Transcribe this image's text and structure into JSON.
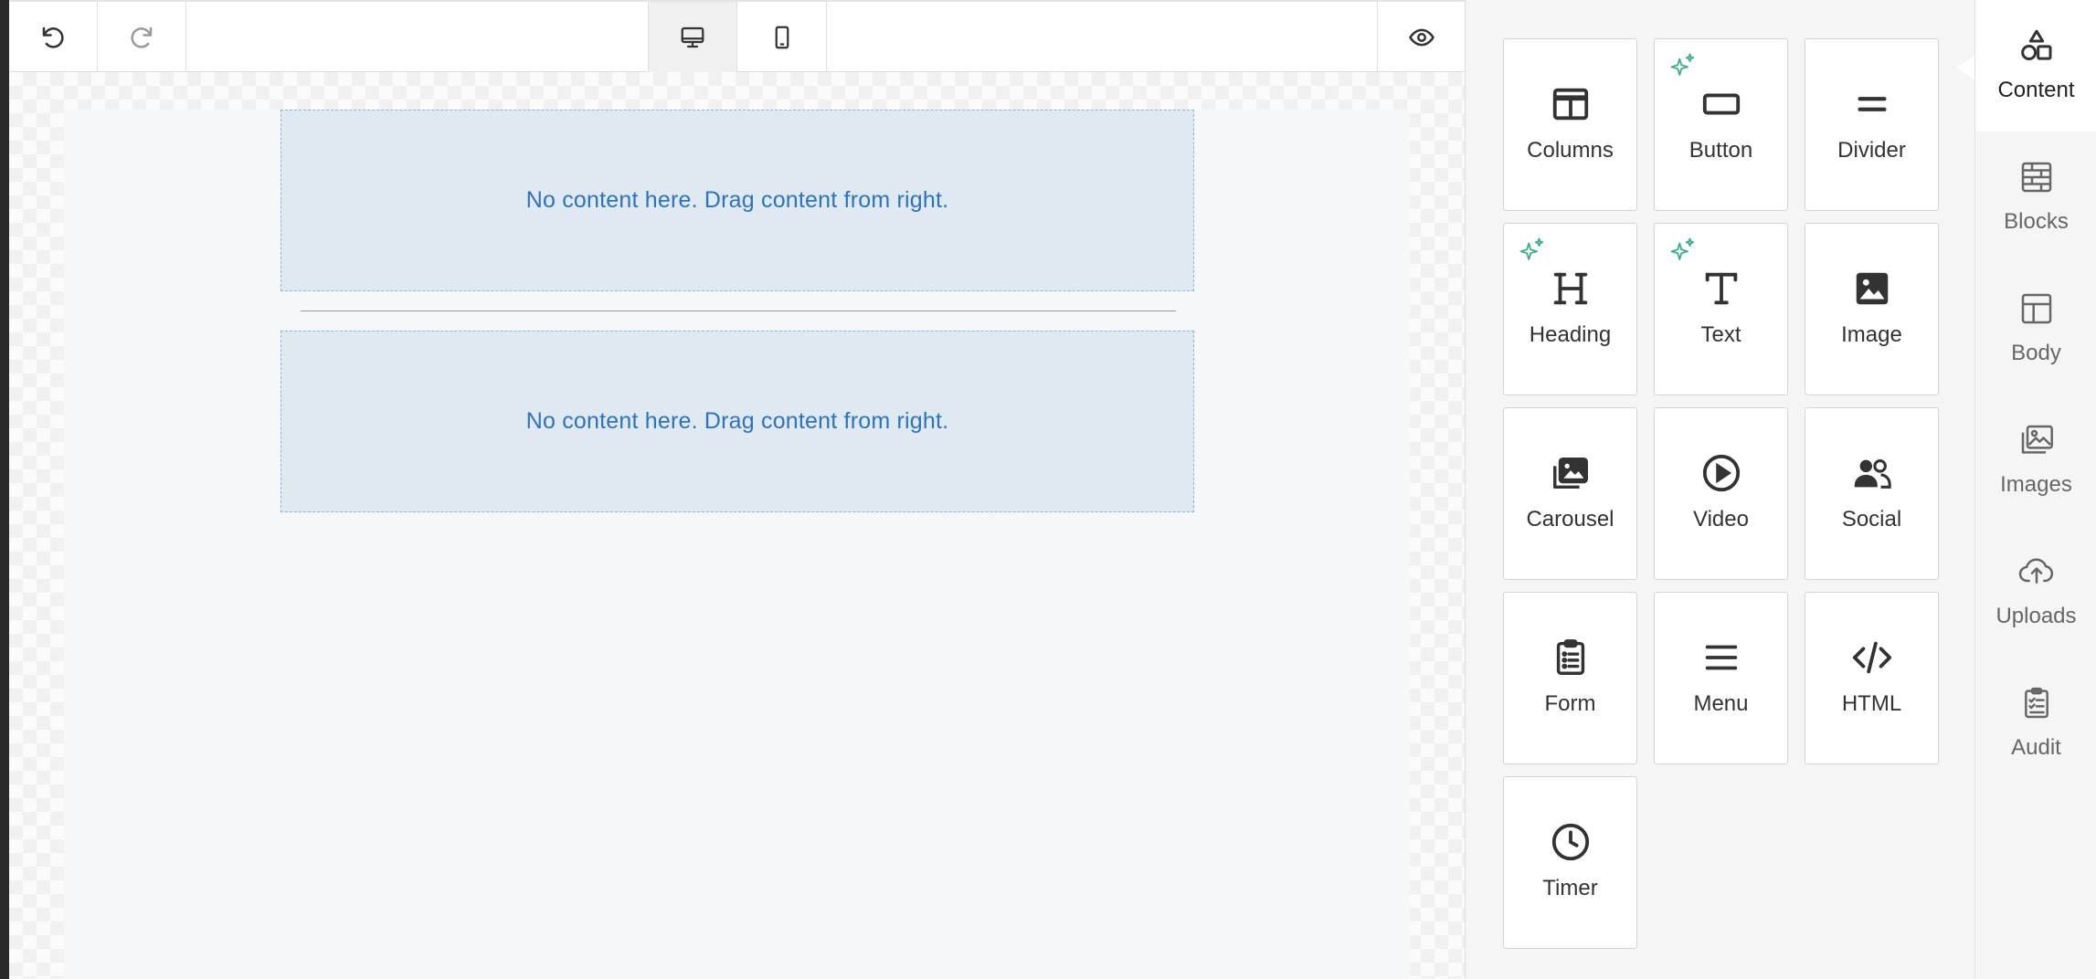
{
  "toolbar": {
    "undo_icon": "undo-icon",
    "redo_icon": "redo-icon",
    "desktop_icon": "desktop-icon",
    "mobile_icon": "mobile-icon",
    "preview_icon": "eye-icon"
  },
  "canvas": {
    "dropzone_1": "No content here. Drag content from right.",
    "dropzone_2": "No content here. Drag content from right."
  },
  "content_tools": [
    {
      "label": "Columns",
      "icon": "columns-icon",
      "ai": false
    },
    {
      "label": "Button",
      "icon": "button-icon",
      "ai": true
    },
    {
      "label": "Divider",
      "icon": "divider-icon",
      "ai": false
    },
    {
      "label": "Heading",
      "icon": "heading-icon",
      "ai": true
    },
    {
      "label": "Text",
      "icon": "text-icon",
      "ai": true
    },
    {
      "label": "Image",
      "icon": "image-icon",
      "ai": false
    },
    {
      "label": "Carousel",
      "icon": "carousel-icon",
      "ai": false
    },
    {
      "label": "Video",
      "icon": "video-icon",
      "ai": false
    },
    {
      "label": "Social",
      "icon": "social-icon",
      "ai": false
    },
    {
      "label": "Form",
      "icon": "form-icon",
      "ai": false
    },
    {
      "label": "Menu",
      "icon": "menu-icon",
      "ai": false
    },
    {
      "label": "HTML",
      "icon": "html-icon",
      "ai": false
    },
    {
      "label": "Timer",
      "icon": "timer-icon",
      "ai": false
    }
  ],
  "nav": [
    {
      "label": "Content",
      "icon": "shapes-icon",
      "active": true
    },
    {
      "label": "Blocks",
      "icon": "blocks-icon",
      "active": false
    },
    {
      "label": "Body",
      "icon": "body-layout-icon",
      "active": false
    },
    {
      "label": "Images",
      "icon": "images-icon",
      "active": false
    },
    {
      "label": "Uploads",
      "icon": "cloud-upload-icon",
      "active": false
    },
    {
      "label": "Audit",
      "icon": "audit-icon",
      "active": false
    }
  ],
  "colors": {
    "accent_text": "#2f72bd",
    "dropzone_bg": "#dfe9f2",
    "ai_sparkle": "#3fae8c"
  }
}
